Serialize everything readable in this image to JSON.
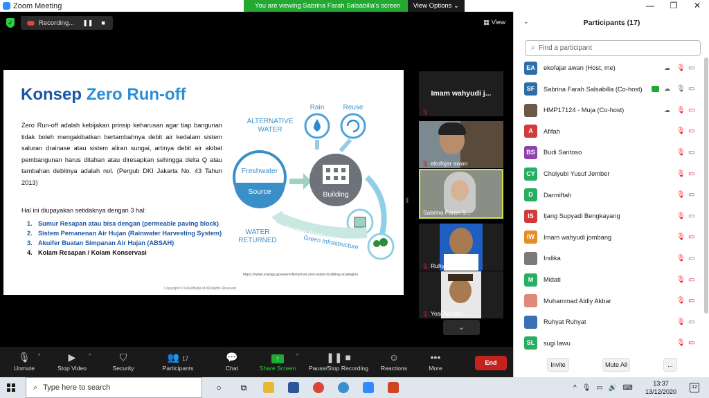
{
  "window": {
    "title": "Zoom Meeting",
    "banner_text": "You are viewing Sabrina Farah Salsabilla's screen",
    "view_options": "View Options ⌄",
    "minimize": "—",
    "maximize": "❐",
    "close": "✕"
  },
  "meeting": {
    "recording_label": "Recording...",
    "pause_glyph": "❚❚",
    "stop_glyph": "■",
    "view_label": "View",
    "view_icon": "grid-icon"
  },
  "slide": {
    "title_part1": "Konsep ",
    "title_part2": "Zero Run-off",
    "paragraph": "Zero Run-off adalah kebijakan prinsip keharusan agar tiap bangunan tidak boleh mengakibatkan bertambahnya debit air kedalam sistem saluran drainase atau sistem aliran sungai, artinya debit air akibat pembangunan harus ditahan atau diresapkan sehingga delta Q atau tambahan debitnya adalah nol. (Pergub DKI Jakarta No. 43 Tahun 2013)",
    "subheading": "Hal ini diupayakan setidaknya dengan 3 hal:",
    "list": [
      {
        "num": "1.",
        "text": "Sumur Resapan atau bisa dengan (permeable paving block)"
      },
      {
        "num": "2.",
        "text": "Sistem Pemanenan Air Hujan (Rainwater Harvesting System)"
      },
      {
        "num": "3.",
        "text": "Akuifer Buatan Simpanan Air Hujan (ABSAH)"
      },
      {
        "num": "4.",
        "text": "Kolam Resapan / Kolam Konservasi"
      }
    ],
    "diagram": {
      "alt_water": "ALTERNATIVE",
      "alt_water2": "WATER",
      "rain": "Rain",
      "reuse": "Reuse",
      "freshwater": "Freshwater",
      "source": "Source",
      "building": "Building",
      "water_returned": "WATER",
      "water_returned2": "RETURNED",
      "treated": "Treated Wastewater",
      "green": "Green Infrastructure"
    },
    "url": "https://www.energy.gov/eere/femp/net-zero-water-building-strategies",
    "copyright": "Copyright © SolusiBanjir.id All Rights Reserved"
  },
  "gallery": {
    "tiles": [
      {
        "name": "Imam wahyudi j...",
        "video": false
      },
      {
        "name": "ekofajar awan",
        "video": true
      },
      {
        "name": "Sabrina Farah S...",
        "video": true,
        "active": true
      },
      {
        "name": "Ruhyat Ruhyat",
        "video": true
      },
      {
        "name": "Yosi Agustia...",
        "video": true
      }
    ],
    "down_glyph": "⌄"
  },
  "toolbar": {
    "unmute": "Unmute",
    "stop_video": "Stop Video",
    "security": "Security",
    "participants": "Participants",
    "participants_count": "17",
    "chat": "Chat",
    "share_screen": "Share Screen",
    "pause_stop_recording": "Pause/Stop Recording",
    "reactions": "Reactions",
    "more": "More",
    "end": "End"
  },
  "panel": {
    "title": "Participants (17)",
    "search_placeholder": "Find a participant",
    "participants": [
      {
        "initials": "EA",
        "name": "ekofajar awan (Host, me)",
        "color": "#2d6ea8"
      },
      {
        "initials": "SF",
        "name": "Sabrina Farah Salsabilla (Co-host)",
        "color": "#2d6ea8"
      },
      {
        "initials": "",
        "name": "HMP17124 - Muja (Co-host)",
        "color": "#6b5a4a"
      },
      {
        "initials": "A",
        "name": "Afifah",
        "color": "#d23b3b"
      },
      {
        "initials": "BS",
        "name": "Budi Santoso",
        "color": "#8e44ad"
      },
      {
        "initials": "CY",
        "name": "Cholyubi Yusuf Jember",
        "color": "#27ae60"
      },
      {
        "initials": "D",
        "name": "Darmiftah",
        "color": "#27ae60"
      },
      {
        "initials": "IS",
        "name": "Ijang Supyadi Bengkayang",
        "color": "#d23b3b"
      },
      {
        "initials": "IW",
        "name": "Imam wahyudi jombang",
        "color": "#e58e26"
      },
      {
        "initials": "",
        "name": "Indika",
        "color": "#7a7a7a"
      },
      {
        "initials": "M",
        "name": "Midati",
        "color": "#27ae60"
      },
      {
        "initials": "",
        "name": "Muhammad Aldiy Akbar",
        "color": "#e0897a"
      },
      {
        "initials": "",
        "name": "Ruhyat Ruhyat",
        "color": "#3b6fb6"
      },
      {
        "initials": "SL",
        "name": "sugi lawu",
        "color": "#27ae60"
      }
    ],
    "invite": "Invite",
    "mute_all": "Mute All",
    "more": "..."
  },
  "taskbar": {
    "search_placeholder": "Type here to search",
    "time": "13:37",
    "date": "13/12/2020",
    "notif_count": "12"
  }
}
